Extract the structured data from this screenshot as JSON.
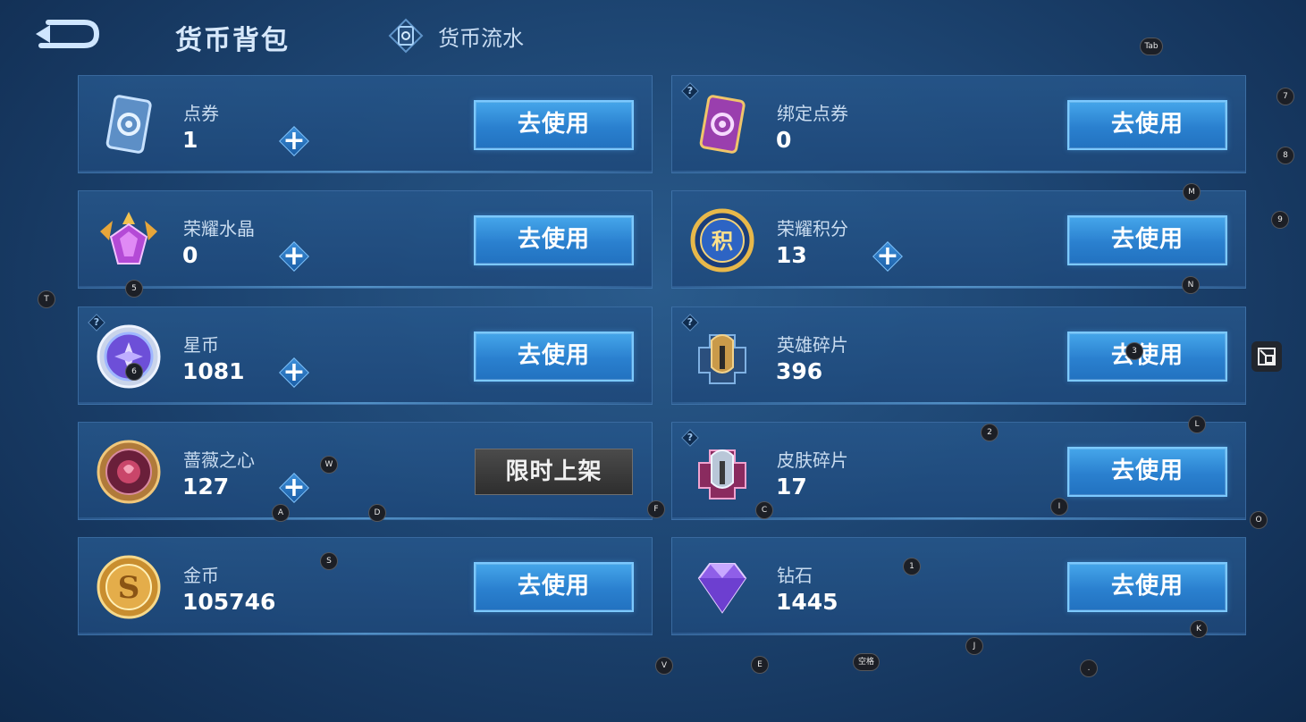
{
  "header": {
    "title": "货币背包",
    "flow_tab_label": "货币流水"
  },
  "cards": [
    {
      "name": "点券",
      "amount": "1",
      "action": "去使用",
      "plus": true,
      "help": false,
      "icon": "coupon-icon"
    },
    {
      "name": "绑定点券",
      "amount": "0",
      "action": "去使用",
      "plus": false,
      "help": true,
      "icon": "bound-coupon-icon"
    },
    {
      "name": "荣耀水晶",
      "amount": "0",
      "action": "去使用",
      "plus": true,
      "help": false,
      "icon": "glory-crystal-icon"
    },
    {
      "name": "荣耀积分",
      "amount": "13",
      "action": "去使用",
      "plus": true,
      "help": false,
      "icon": "glory-points-icon"
    },
    {
      "name": "星币",
      "amount": "1081",
      "action": "去使用",
      "plus": true,
      "help": true,
      "icon": "star-coin-icon"
    },
    {
      "name": "英雄碎片",
      "amount": "396",
      "action": "去使用",
      "plus": false,
      "help": true,
      "icon": "hero-shard-icon"
    },
    {
      "name": "蔷薇之心",
      "amount": "127",
      "action": "限时上架",
      "plus": true,
      "help": false,
      "icon": "rose-heart-icon"
    },
    {
      "name": "皮肤碎片",
      "amount": "17",
      "action": "去使用",
      "plus": false,
      "help": true,
      "icon": "skin-shard-icon"
    },
    {
      "name": "金币",
      "amount": "105746",
      "action": "去使用",
      "plus": false,
      "help": false,
      "icon": "gold-coin-icon"
    },
    {
      "name": "钻石",
      "amount": "1445",
      "action": "去使用",
      "plus": false,
      "help": false,
      "icon": "diamond-icon"
    }
  ],
  "key_hints": [
    "Tab",
    "7",
    "8",
    "M",
    "9",
    "N",
    "T",
    "5",
    "6",
    "3",
    "L",
    "2",
    "W",
    "F",
    "C",
    "I",
    "A",
    "D",
    "O",
    "1",
    "S",
    "K",
    "J",
    "V",
    "E",
    "空格",
    "."
  ],
  "colors": {
    "accent": "#3a96e0",
    "card_bg": "#26568a",
    "button_border": "#7cc9ff"
  }
}
